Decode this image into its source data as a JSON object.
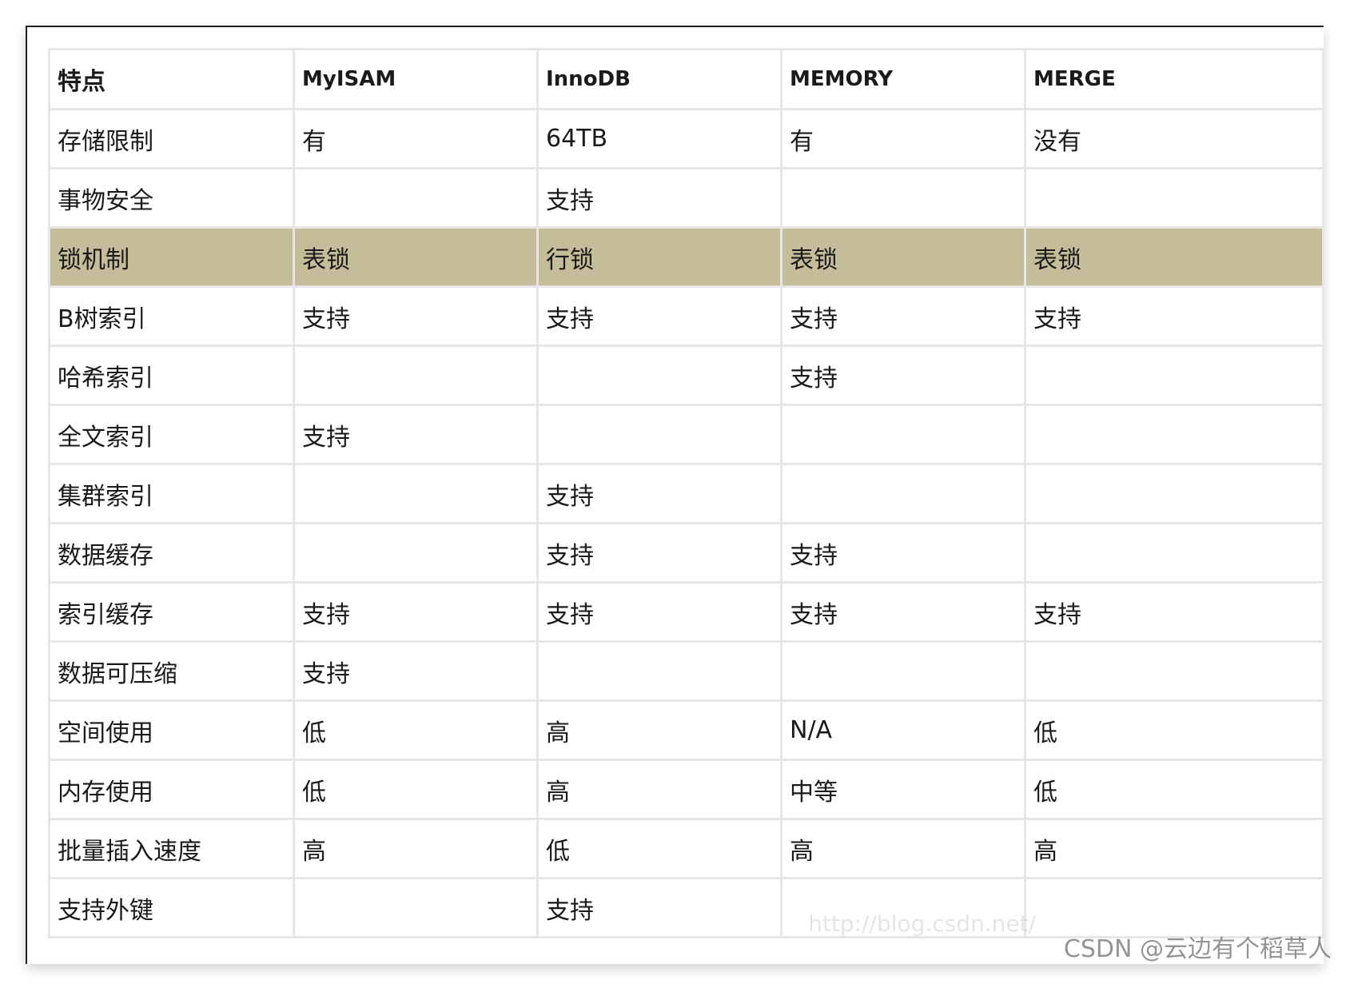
{
  "table": {
    "headers": [
      "特点",
      "MyISAM",
      "InnoDB",
      "MEMORY",
      "MERGE"
    ],
    "rows": [
      [
        "存储限制",
        "有",
        "64TB",
        "有",
        "没有"
      ],
      [
        "事物安全",
        "",
        "支持",
        "",
        ""
      ],
      [
        "锁机制",
        "表锁",
        "行锁",
        "表锁",
        "表锁"
      ],
      [
        "B树索引",
        "支持",
        "支持",
        "支持",
        "支持"
      ],
      [
        "哈希索引",
        "",
        "",
        "支持",
        ""
      ],
      [
        "全文索引",
        "支持",
        "",
        "",
        ""
      ],
      [
        "集群索引",
        "",
        "支持",
        "",
        ""
      ],
      [
        "数据缓存",
        "",
        "支持",
        "支持",
        ""
      ],
      [
        "索引缓存",
        "支持",
        "支持",
        "支持",
        "支持"
      ],
      [
        "数据可压缩",
        "支持",
        "",
        "",
        ""
      ],
      [
        "空间使用",
        "低",
        "高",
        "N/A",
        "低"
      ],
      [
        "内存使用",
        "低",
        "高",
        "中等",
        "低"
      ],
      [
        "批量插入速度",
        "高",
        "低",
        "高",
        "高"
      ],
      [
        "支持外键",
        "",
        "支持",
        "",
        ""
      ]
    ],
    "highlighted_row": 2,
    "highlight_color": "#c5bd99"
  },
  "watermark": "CSDN @云边有个稻草人"
}
